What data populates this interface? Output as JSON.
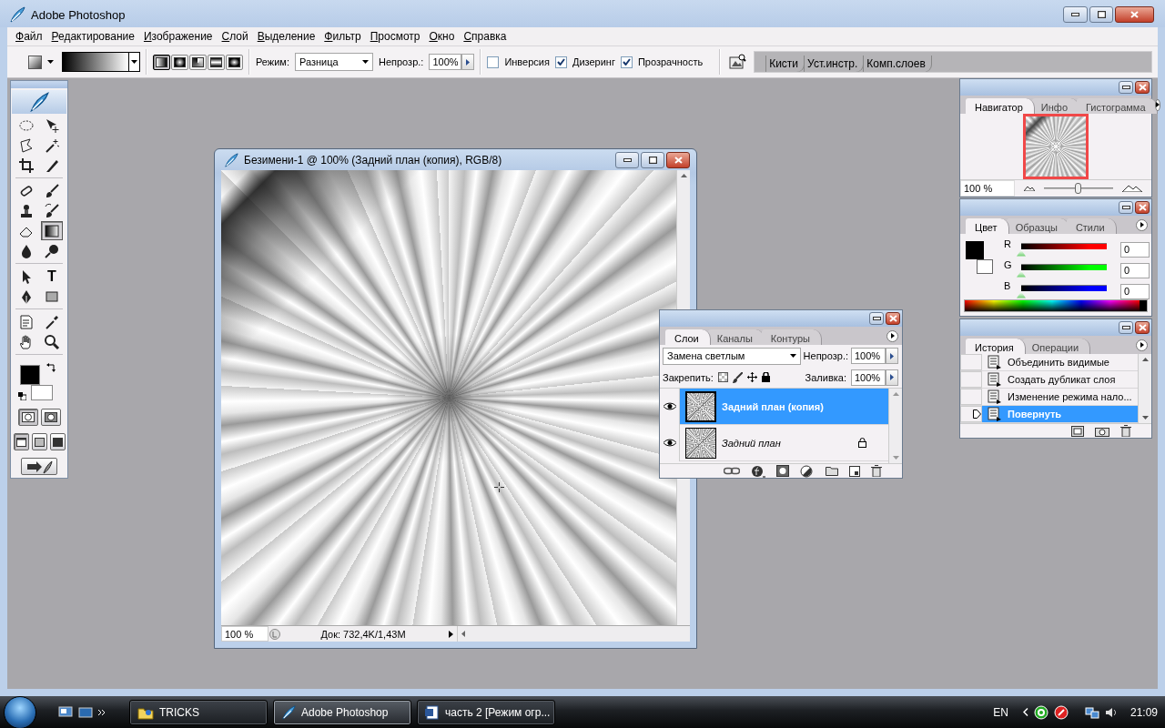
{
  "app": {
    "title": "Adobe Photoshop"
  },
  "menu": [
    {
      "label": "Файл"
    },
    {
      "label": "Редактирование"
    },
    {
      "label": "Изображение"
    },
    {
      "label": "Слой"
    },
    {
      "label": "Выделение"
    },
    {
      "label": "Фильтр"
    },
    {
      "label": "Просмотр"
    },
    {
      "label": "Окно"
    },
    {
      "label": "Справка"
    }
  ],
  "options_bar": {
    "gradient_types": [
      {
        "kind": "linear",
        "selected": true
      },
      {
        "kind": "radial",
        "selected": false
      },
      {
        "kind": "angle",
        "selected": false
      },
      {
        "kind": "reflected",
        "selected": false
      },
      {
        "kind": "diamond",
        "selected": false
      }
    ],
    "mode_label": "Режим:",
    "mode_value": "Разница",
    "opacity_label": "Непрозр.:",
    "opacity_value": "100%",
    "options": [
      {
        "label": "Инверсия",
        "checked": false
      },
      {
        "label": "Дизеринг",
        "checked": true
      },
      {
        "label": "Прозрачность",
        "checked": true
      }
    ],
    "well_tabs": [
      {
        "label": "Кисти"
      },
      {
        "label": "Уст.инстр."
      },
      {
        "label": "Комп.слоев"
      }
    ]
  },
  "toolbox": {
    "tools": [
      {
        "kind": "marquee",
        "selected": false
      },
      {
        "kind": "move",
        "selected": false
      },
      {
        "kind": "lasso",
        "selected": false
      },
      {
        "kind": "wand",
        "selected": false
      },
      {
        "kind": "crop",
        "selected": false
      },
      {
        "kind": "slice",
        "selected": false
      },
      {
        "kind": "healing",
        "selected": false
      },
      {
        "kind": "brush",
        "selected": false
      },
      {
        "kind": "stamp",
        "selected": false
      },
      {
        "kind": "history_brush",
        "selected": false
      },
      {
        "kind": "eraser",
        "selected": false
      },
      {
        "kind": "gradient",
        "selected": true
      },
      {
        "kind": "blur",
        "selected": false
      },
      {
        "kind": "dodge",
        "selected": false
      },
      {
        "kind": "path_select",
        "selected": false
      },
      {
        "kind": "type",
        "label": "T",
        "selected": false
      },
      {
        "kind": "pen",
        "selected": false
      },
      {
        "kind": "shape",
        "selected": false
      },
      {
        "kind": "notes",
        "selected": false
      },
      {
        "kind": "eyedropper",
        "selected": false
      },
      {
        "kind": "hand",
        "selected": false
      },
      {
        "kind": "zoom",
        "selected": false
      }
    ]
  },
  "document": {
    "title": "Безимени-1 @ 100% (Задний план (копия), RGB/8)",
    "zoom": "100 %",
    "doc_info": "Док: 732,4K/1,43M"
  },
  "navigator": {
    "tabs": [
      {
        "label": "Навигатор",
        "selected": true
      },
      {
        "label": "Инфо",
        "selected": false
      },
      {
        "label": "Гистограмма",
        "selected": false
      }
    ],
    "zoom": "100 %",
    "zoom_slider": {
      "level": 0.5
    }
  },
  "color": {
    "tabs": [
      {
        "label": "Цвет",
        "selected": true
      },
      {
        "label": "Образцы",
        "selected": false
      },
      {
        "label": "Стили",
        "selected": false
      }
    ],
    "channels": [
      {
        "name": "R",
        "value": "0",
        "level": 0,
        "color": "#ff0000"
      },
      {
        "name": "G",
        "value": "0",
        "level": 0,
        "color": "#00ff00"
      },
      {
        "name": "B",
        "value": "0",
        "level": 0,
        "color": "#0000ff"
      }
    ]
  },
  "history": {
    "tabs": [
      {
        "label": "История",
        "selected": true
      },
      {
        "label": "Операции",
        "selected": false
      }
    ],
    "items": [
      {
        "label": "Объединить видимые",
        "selected": false
      },
      {
        "label": "Создать дубликат слоя",
        "selected": false
      },
      {
        "label": "Изменение режима нало...",
        "selected": false
      },
      {
        "label": "Повернуть",
        "selected": true
      }
    ]
  },
  "layers": {
    "tabs": [
      {
        "label": "Слои",
        "selected": true
      },
      {
        "label": "Каналы",
        "selected": false
      },
      {
        "label": "Контуры",
        "selected": false
      }
    ],
    "blend_mode": "Замена светлым",
    "opacity_label": "Непрозр.:",
    "opacity_value": "100%",
    "lock_label": "Закрепить:",
    "fill_label": "Заливка:",
    "fill_value": "100%",
    "items": [
      {
        "name": "Задний план (копия)",
        "selected": true,
        "visible": true,
        "locked": false
      },
      {
        "name": "Задний план",
        "selected": false,
        "visible": true,
        "locked": true
      }
    ]
  },
  "taskbar": {
    "buttons": [
      {
        "label": "TRICKS",
        "selected": false
      },
      {
        "label": "Adobe Photoshop",
        "selected": true
      },
      {
        "label": "часть 2 [Режим огр...",
        "selected": false
      }
    ],
    "language": "EN",
    "clock": "21:09"
  }
}
